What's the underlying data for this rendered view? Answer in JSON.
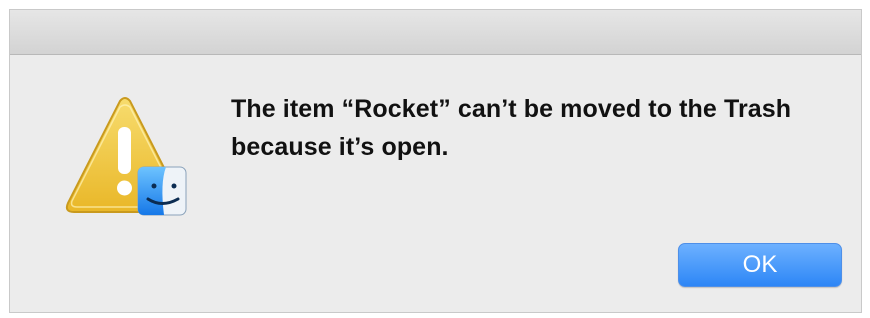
{
  "dialog": {
    "message": "The item “Rocket” can’t be moved to the Trash because it’s open.",
    "ok_label": "OK",
    "icon": "warning-icon",
    "badge_icon": "finder-icon"
  },
  "colors": {
    "background": "#ececec",
    "warning_yellow": "#efc33a",
    "button_blue": "#2d86f6",
    "text": "#111111"
  }
}
